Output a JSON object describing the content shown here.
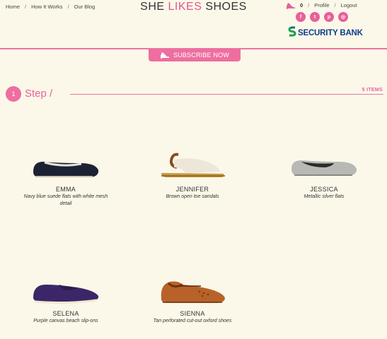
{
  "brand": {
    "part1": "SHE",
    "part2": "LIKES",
    "part3": "SHOES",
    "accent_color": "#e25690"
  },
  "topnav": {
    "items": [
      "Home",
      "How It Works",
      "Our Blog"
    ],
    "separator": "/"
  },
  "usernav": {
    "cart_count": "0",
    "profile": "Profile",
    "logout": "Logout",
    "separator": "/"
  },
  "socials": {
    "icons": [
      "facebook-icon",
      "twitter-icon",
      "pinterest-icon",
      "instagram-icon"
    ],
    "glyphs": [
      "f",
      "t",
      "p",
      "◎"
    ]
  },
  "sponsor": {
    "label": "SECURITY BANK",
    "color": "#0d3c8c"
  },
  "subscribe": {
    "label": "SUBSCRIBE NOW"
  },
  "step": {
    "number": "1",
    "label": "Step /",
    "items_count": "5 ITEMS"
  },
  "products": [
    {
      "name": "EMMA",
      "desc": "Navy blue suede flats with white mesh detail"
    },
    {
      "name": "JENNIFER",
      "desc": "Brown open toe sandals"
    },
    {
      "name": "JESSICA",
      "desc": "Metallic silver flats"
    },
    {
      "name": "SELENA",
      "desc": "Purple canvas beach slip-ons"
    },
    {
      "name": "SIENNA",
      "desc": "Tan perforated cut-out oxford shoes"
    }
  ]
}
